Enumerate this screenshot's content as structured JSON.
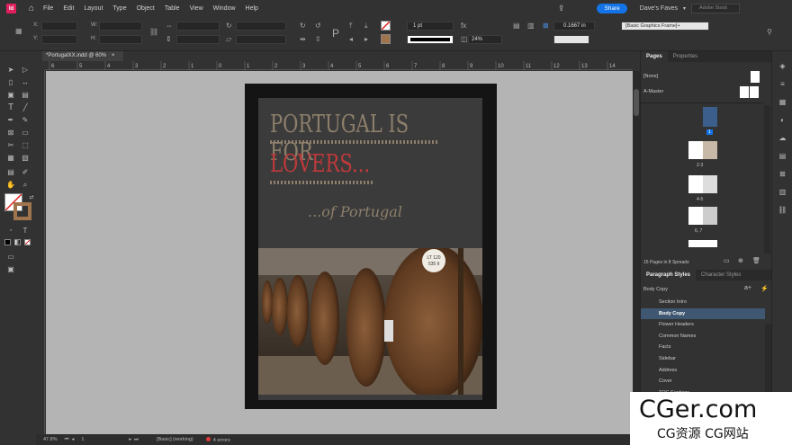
{
  "menubar": {
    "app_icon": "Id",
    "items": [
      "File",
      "Edit",
      "Layout",
      "Type",
      "Object",
      "Table",
      "View",
      "Window",
      "Help"
    ],
    "share": "Share",
    "faves": "Dave's Faves",
    "stock_placeholder": "Adobe Stock"
  },
  "control": {
    "x_label": "X:",
    "y_label": "Y:",
    "w_label": "W:",
    "h_label": "H:",
    "stroke_weight": "1 pt",
    "offset": "0.1667 in",
    "opacity": "24%",
    "frame_style": "[Basic Graphics Frame]+"
  },
  "document": {
    "tab_title": "*PortugalXX.indd @ 60%",
    "ruler_marks": [
      "6",
      "5",
      "4",
      "3",
      "2",
      "1",
      "0",
      "1",
      "2",
      "3",
      "4",
      "5",
      "6",
      "7",
      "8",
      "9",
      "10",
      "11",
      "12",
      "13",
      "14"
    ]
  },
  "cover": {
    "title_line1": "PORTUGAL IS FOR",
    "title_line2": "LOVERS...",
    "subtitle": "...of Portugal",
    "barrel_label1": "LT 120",
    "barrel_label2": "535 lt"
  },
  "pages_panel": {
    "tab_pages": "Pages",
    "tab_properties": "Properties",
    "none_master": "[None]",
    "a_master": "A-Master",
    "page_labels": [
      "1",
      "2-3",
      "4-5",
      "6, 7"
    ],
    "footer": "15 Pages in 8 Spreads"
  },
  "para_panel": {
    "tab_para": "Paragraph Styles",
    "tab_char": "Character Styles",
    "current": "Body Copy",
    "styles": [
      "Section Intro",
      "Body Copy",
      "Flower Headers",
      "Common Names",
      "Facts",
      "Sidebar",
      "Address",
      "Cover",
      "TOC Sections"
    ],
    "selected_index": 1
  },
  "statusbar": {
    "zoom": "47.8%",
    "page": "1",
    "style": "[Basic] (working)",
    "errors": "4 errors"
  },
  "watermark": {
    "line1": "CGer.com",
    "line2": "CG资源 CG网站"
  },
  "colors": {
    "title_tan": "#8d7f6b",
    "title_red": "#c0393b",
    "selection_blue": "#3f5770",
    "share_blue": "#1473e6"
  }
}
